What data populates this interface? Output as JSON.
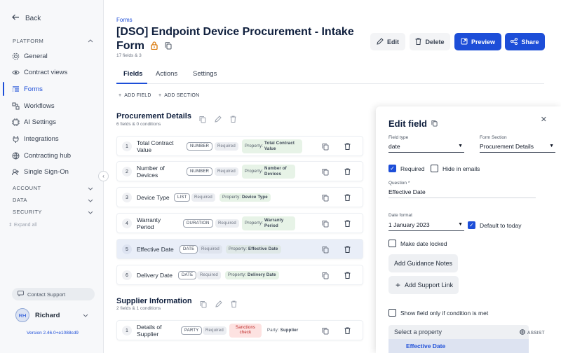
{
  "sidebar": {
    "back_label": "Back",
    "platform_label": "PLATFORM",
    "items": [
      {
        "label": "General",
        "icon": "gear-icon"
      },
      {
        "label": "Contract views",
        "icon": "eye-icon"
      },
      {
        "label": "Forms",
        "icon": "form-icon"
      },
      {
        "label": "Workflows",
        "icon": "workflow-icon"
      },
      {
        "label": "AI Settings",
        "icon": "ai-icon"
      },
      {
        "label": "Integrations",
        "icon": "integrations-icon"
      },
      {
        "label": "Contracting hub",
        "icon": "hub-icon"
      },
      {
        "label": "Single Sign-On",
        "icon": "sso-icon"
      }
    ],
    "account_label": "ACCOUNT",
    "data_label": "DATA",
    "security_label": "SECURITY",
    "expand_all": "Expand all",
    "contact_support": "Contact Support",
    "user_initials": "RH",
    "user_name": "Richard",
    "version": "Version 2.46.0+e1088cd9"
  },
  "header": {
    "breadcrumb": "Forms",
    "title": "[DSO] Endpoint Device Procurement - Intake Form",
    "subtitle": "17 fields & 3",
    "edit": "Edit",
    "delete": "Delete",
    "preview": "Preview",
    "share": "Share"
  },
  "tabs": [
    "Fields",
    "Actions",
    "Settings"
  ],
  "add_field": "ADD FIELD",
  "add_section": "ADD SECTION",
  "sections": [
    {
      "title": "Procurement Details",
      "subtitle": "6 fields & 0 conditions",
      "rows": [
        {
          "num": "1",
          "name": "Total Contract Value",
          "type": "NUMBER",
          "required": "Required",
          "prop_label": "Property:",
          "prop": "Total Contract Value"
        },
        {
          "num": "2",
          "name": "Number of Devices",
          "type": "NUMBER",
          "required": "Required",
          "prop_label": "Property:",
          "prop": "Number of Devices"
        },
        {
          "num": "3",
          "name": "Device Type",
          "type": "LIST",
          "required": "Required",
          "prop_label": "Property:",
          "prop": "Device Type"
        },
        {
          "num": "4",
          "name": "Warranty Period",
          "type": "DURATION",
          "required": "Required",
          "prop_label": "Property:",
          "prop": "Warranty Period"
        },
        {
          "num": "5",
          "name": "Effective Date",
          "type": "DATE",
          "required": "Required",
          "prop_label": "Property:",
          "prop": "Effective Date"
        },
        {
          "num": "6",
          "name": "Delivery Date",
          "type": "DATE",
          "required": "Required",
          "prop_label": "Property:",
          "prop": "Delivery Date"
        }
      ]
    },
    {
      "title": "Supplier Information",
      "subtitle": "2 fields & 1 conditions",
      "rows": [
        {
          "num": "1",
          "name": "Details of Supplier",
          "type": "PARTY",
          "required": "Required",
          "sanctions": "Sanctions check",
          "prop_label": "Party:",
          "prop": "Supplier"
        }
      ]
    }
  ],
  "panel": {
    "title": "Edit field",
    "field_type_label": "Field type",
    "field_type": "date",
    "form_section_label": "Form Section",
    "form_section": "Procurement Details",
    "required_label": "Required",
    "hide_emails_label": "Hide in emails",
    "question_label": "Question *",
    "question": "Effective Date",
    "date_format_label": "Date format",
    "date_format": "1 January 2023",
    "default_today": "Default to today",
    "make_locked": "Make date locked",
    "add_guidance": "Add Guidance Notes",
    "add_support": "Add Support Link",
    "show_condition": "Show field only if condition is met",
    "select_property": "Select a property",
    "assist": "ASSIST",
    "dropdown_item": "Effective Date"
  },
  "colors": {
    "primary": "#1d4ed8",
    "required_check": "#1d4ed8",
    "sanctions": "#b91c1c",
    "property_pill": "#e7f3e7"
  }
}
